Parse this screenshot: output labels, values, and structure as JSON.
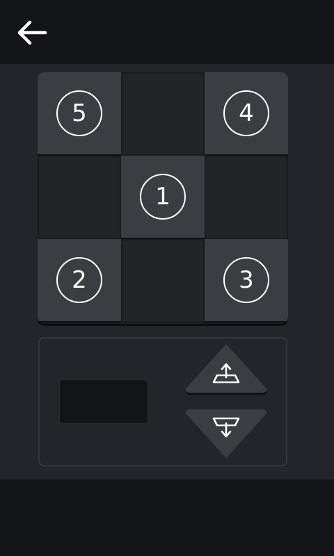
{
  "header": {
    "back_icon": "arrow-left-icon"
  },
  "grid": {
    "positions": [
      {
        "label": "5"
      },
      {
        "label": "4"
      },
      {
        "label": "1"
      },
      {
        "label": "2"
      },
      {
        "label": "3"
      }
    ]
  },
  "controls": {
    "display_value": "",
    "up_icon": "move-up-icon",
    "down_icon": "move-down-icon"
  },
  "colors": {
    "background": "#131417",
    "panel": "#222529",
    "tile_raised": "#3a3d42",
    "tile_sunken": "#222428",
    "foreground": "#ffffff"
  }
}
